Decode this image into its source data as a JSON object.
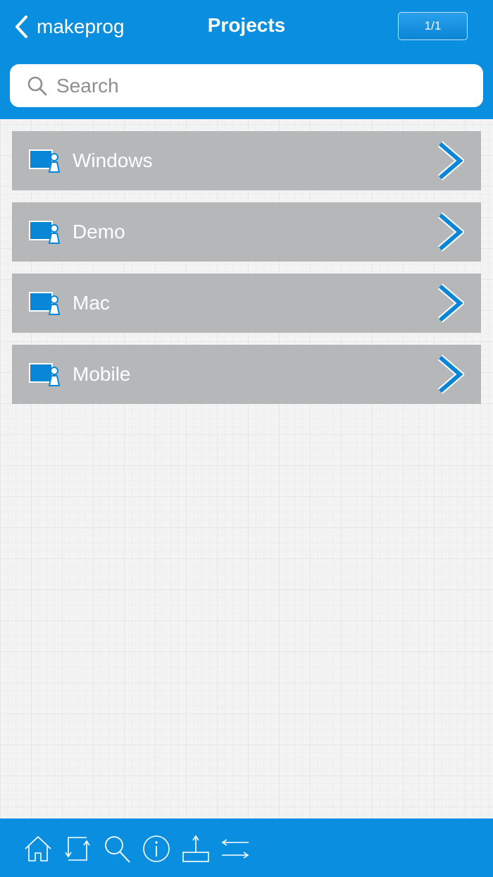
{
  "nav": {
    "back_label": "makeprog",
    "title": "Projects",
    "page_indicator": "1/1"
  },
  "search": {
    "placeholder": "Search",
    "value": ""
  },
  "projects": [
    {
      "label": "Windows"
    },
    {
      "label": "Demo"
    },
    {
      "label": "Mac"
    },
    {
      "label": "Mobile"
    }
  ],
  "toolbar": {
    "icons": [
      "home-icon",
      "sync-icon",
      "search-icon",
      "info-icon",
      "export-icon",
      "transfer-icon"
    ]
  },
  "colors": {
    "accent": "#0a8ee0",
    "row_background": "#b6b7b9",
    "icon_blue": "#0a86d6"
  }
}
